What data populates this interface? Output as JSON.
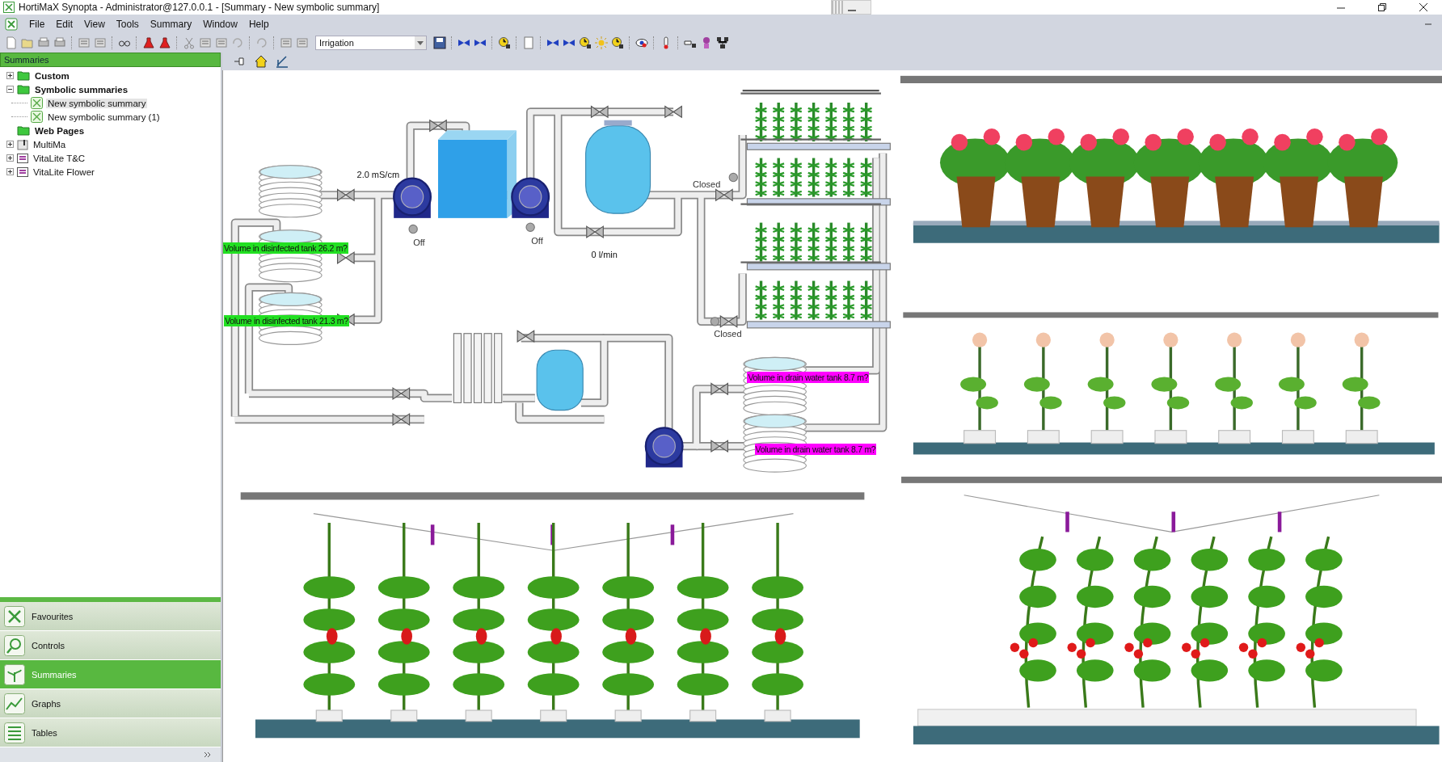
{
  "window": {
    "title": "HortiMaX Synopta - Administrator@127.0.0.1 - [Summary - New symbolic summary]"
  },
  "menu": [
    "File",
    "Edit",
    "View",
    "Tools",
    "Summary",
    "Window",
    "Help"
  ],
  "toolbar": {
    "combo_value": "Irrigation"
  },
  "sidebar": {
    "header": "Summaries",
    "tree": [
      {
        "label": "Custom",
        "kind": "folder",
        "expanded": false,
        "selected": false
      },
      {
        "label": "Symbolic summaries",
        "kind": "folder",
        "expanded": true,
        "selected": false,
        "children": [
          {
            "label": "New symbolic summary",
            "kind": "summary",
            "selected": true
          },
          {
            "label": "New symbolic summary (1)",
            "kind": "summary",
            "selected": false
          }
        ]
      },
      {
        "label": "Web Pages",
        "kind": "folder",
        "selected": false
      },
      {
        "label": "MultiMa",
        "kind": "device",
        "expanded": false,
        "selected": false
      },
      {
        "label": "VitaLite T&C",
        "kind": "list",
        "expanded": false,
        "selected": false
      },
      {
        "label": "VitaLite Flower",
        "kind": "list",
        "expanded": false,
        "selected": false
      }
    ],
    "nav": [
      {
        "label": "Favourites",
        "kind": "favourites",
        "selected": false
      },
      {
        "label": "Controls",
        "kind": "controls",
        "selected": false
      },
      {
        "label": "Summaries",
        "kind": "summaries",
        "selected": true
      },
      {
        "label": "Graphs",
        "kind": "graphs",
        "selected": false
      },
      {
        "label": "Tables",
        "kind": "tables",
        "selected": false
      }
    ]
  },
  "diagram": {
    "readings": [
      {
        "text": "2.0 mS/cm",
        "kind": "reading"
      },
      {
        "text": "Off",
        "kind": "status"
      },
      {
        "text": "Off",
        "kind": "status"
      },
      {
        "text": "0 l/min",
        "kind": "reading"
      },
      {
        "text": "Closed",
        "kind": "status"
      },
      {
        "text": "Closed",
        "kind": "status"
      }
    ],
    "volume_labels": [
      {
        "text": "Volume in disinfected tank 26.2 m?",
        "color": "#22e022"
      },
      {
        "text": "Volume in disinfected tank 21.3 m?",
        "color": "#22e022"
      },
      {
        "text": "Volume in drain water tank 8.7 m?",
        "color": "#ff00ff"
      },
      {
        "text": "Volume in drain water tank 8.7 m?",
        "color": "#ff00ff"
      }
    ]
  }
}
